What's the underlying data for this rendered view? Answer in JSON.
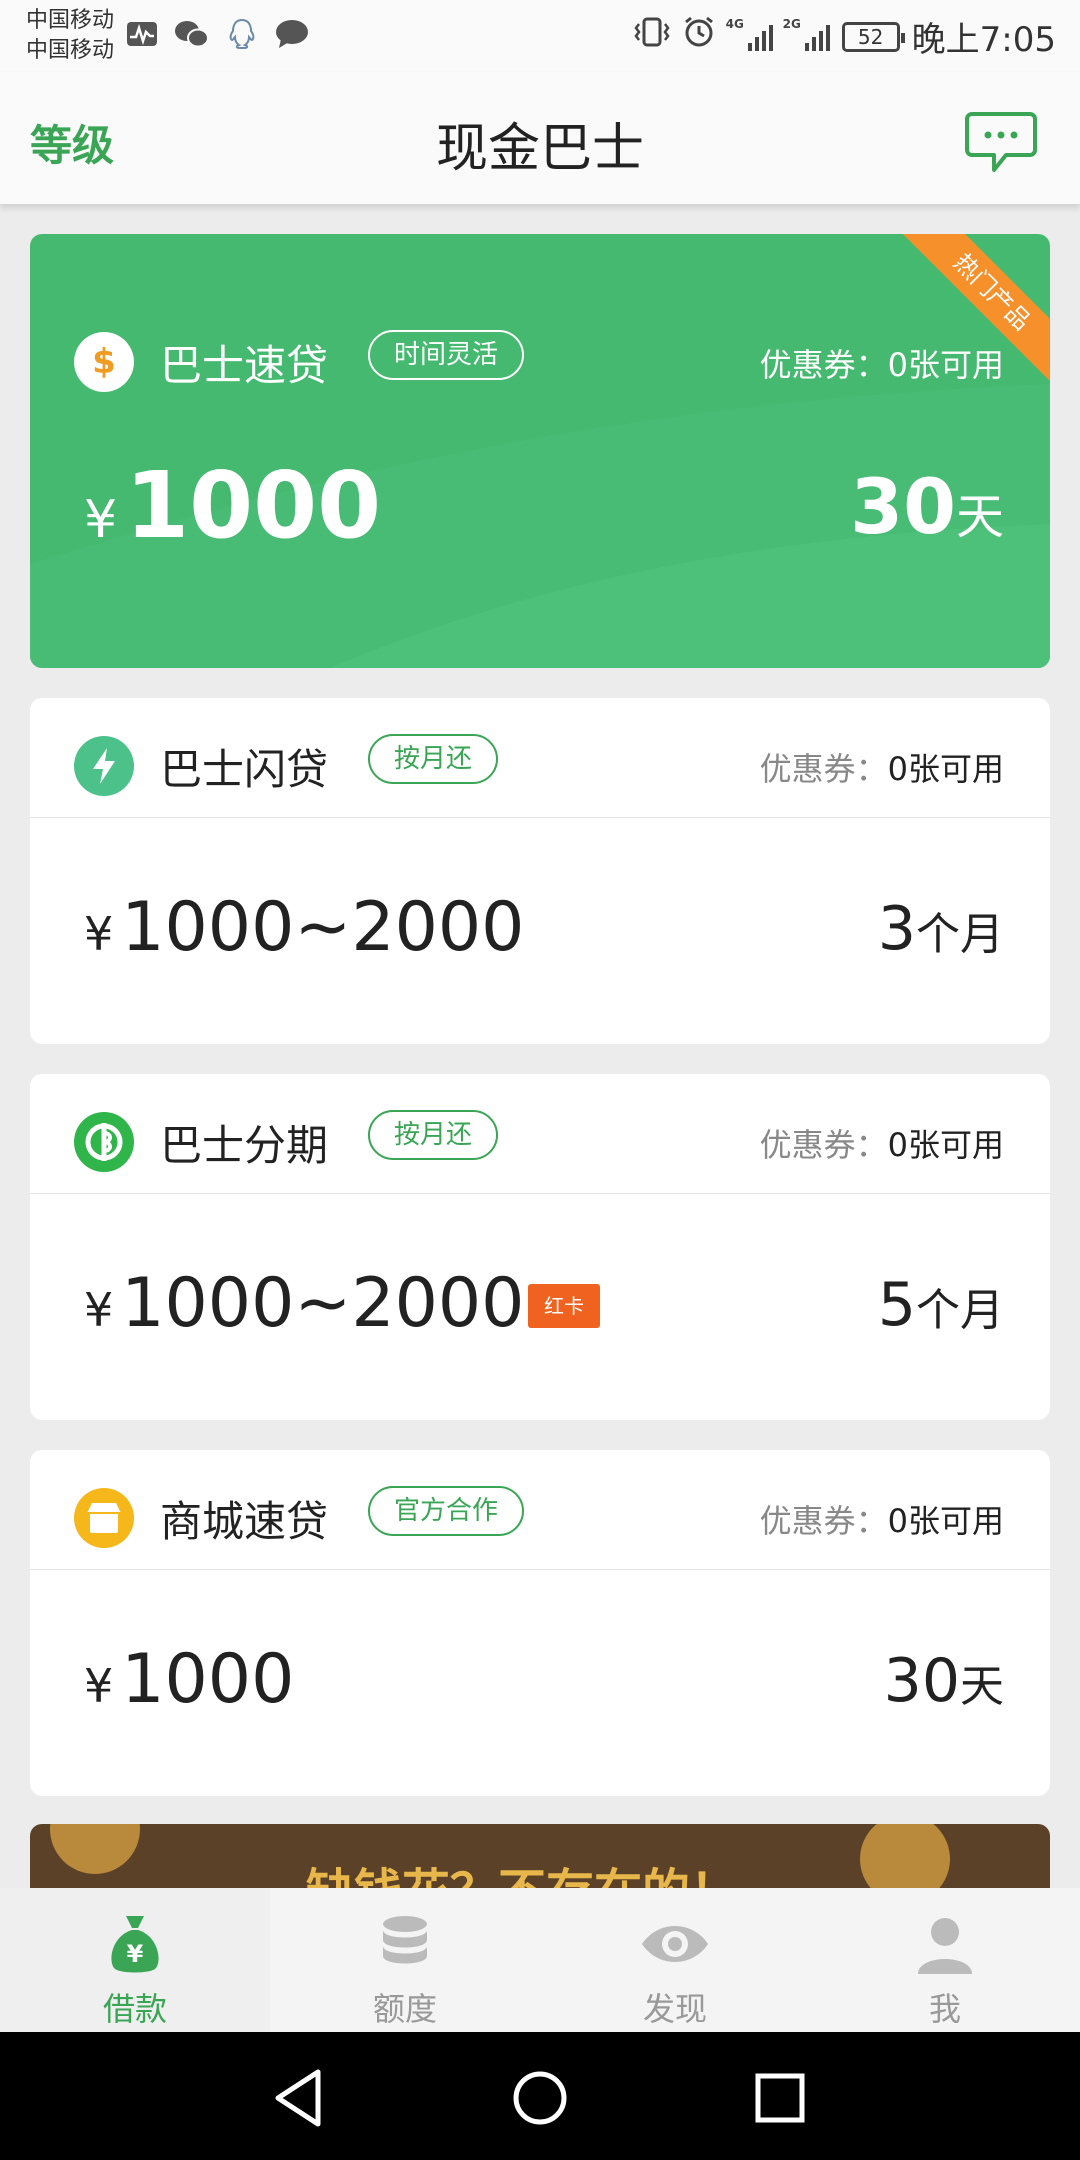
{
  "status_bar": {
    "carrier_1": "中国移动",
    "carrier_2": "中国移动",
    "net_4g": "4G",
    "net_2g": "2G",
    "battery": "52",
    "time": "晚上7:05"
  },
  "header": {
    "level_label": "等级",
    "title": "现金巴士"
  },
  "products": [
    {
      "name": "巴士速贷",
      "tag": "时间灵活",
      "coupon_label": "优惠券：",
      "coupon_value": "0张可用",
      "currency": "¥",
      "amount": "1000",
      "term_number": "30",
      "term_unit": "天",
      "ribbon": "热门产品",
      "icon": "dollar-icon",
      "icon_glyph": "$",
      "icon_color": "#f09b22"
    },
    {
      "name": "巴士闪贷",
      "tag": "按月还",
      "coupon_label": "优惠券：",
      "coupon_value": "0张可用",
      "currency": "¥",
      "amount": "1000~2000",
      "term_number": "3",
      "term_unit": "个月",
      "icon": "lightning-icon",
      "icon_color": "#4cc28a"
    },
    {
      "name": "巴士分期",
      "tag": "按月还",
      "coupon_label": "优惠券：",
      "coupon_value": "0张可用",
      "currency": "¥",
      "amount": "1000~2000",
      "badge": "红卡",
      "term_number": "5",
      "term_unit": "个月",
      "icon": "installment-icon",
      "icon_color": "#2fb54a"
    },
    {
      "name": "商城速贷",
      "tag": "官方合作",
      "coupon_label": "优惠券：",
      "coupon_value": "0张可用",
      "currency": "¥",
      "amount": "1000",
      "term_number": "30",
      "term_unit": "天",
      "icon": "shop-icon",
      "icon_color": "#f5b71a"
    }
  ],
  "banner": {
    "text": "缺钱花？不存在的！"
  },
  "bottom_nav": [
    {
      "label": "借款",
      "icon": "money-bag-icon",
      "active": true
    },
    {
      "label": "额度",
      "icon": "coin-stack-icon",
      "active": false
    },
    {
      "label": "发现",
      "icon": "eye-icon",
      "active": false
    },
    {
      "label": "我",
      "icon": "person-icon",
      "active": false
    }
  ],
  "colors": {
    "accent_green": "#3aa655",
    "hero_green": "#44b96f",
    "ribbon_orange": "#f5902a",
    "badge_red": "#f0621f"
  }
}
